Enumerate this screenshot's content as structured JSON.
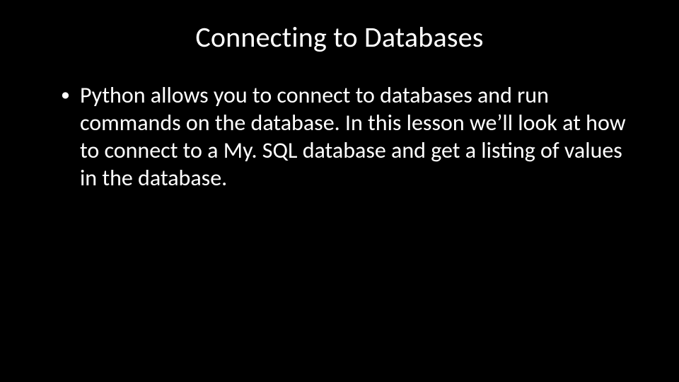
{
  "slide": {
    "title": "Connecting to Databases",
    "bullets": [
      {
        "text": "Python allows you to connect to databases and run commands on the database. In this lesson we’ll look at how to connect to a My. SQL database and get a listing of values in the database."
      }
    ]
  }
}
